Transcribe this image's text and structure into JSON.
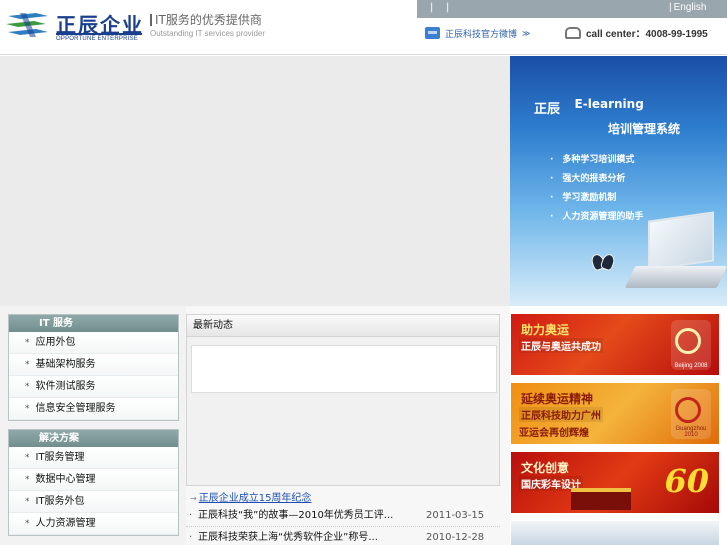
{
  "header": {
    "logo_cn": "正辰企业",
    "logo_en": "OPPORTUNE ENTERPRISE",
    "slogan_cn": "IT服务的优秀提供商",
    "slogan_en": "Outstanding IT services provider",
    "topbar": {
      "sep1": "|",
      "sep2": "|",
      "lang": "English"
    },
    "weibo_label": "正辰科技官方微博",
    "weibo_arrow": "≫",
    "call_center": "call center：4008-99-1995"
  },
  "banner": {
    "brand": "正辰",
    "title_en": "E-learning",
    "subtitle": "培训管理系统",
    "features": [
      "多种学习培训模式",
      "强大的报表分析",
      "学习激励机制",
      "人力资源管理的助手"
    ]
  },
  "sidebar": {
    "sections": [
      {
        "title": "IT 服务",
        "items": [
          "应用外包",
          "基础架构服务",
          "软件测试服务",
          "信息安全管理服务"
        ]
      },
      {
        "title": "解决方案",
        "items": [
          "IT服务管理",
          "数据中心管理",
          "IT服务外包",
          "人力资源管理"
        ]
      }
    ]
  },
  "main": {
    "panel_title": "最新动态",
    "more_link": "正辰企业成立15周年纪念",
    "news": [
      {
        "title": "正辰科技“我”的故事—2010年优秀员工评...",
        "date": "2011-03-15"
      },
      {
        "title": "正辰科技荣获上海“优秀软件企业”称号...",
        "date": "2010-12-28"
      }
    ]
  },
  "ads": [
    {
      "line1": "助力奥运",
      "line2": "正辰与奥运共成功",
      "line3": "",
      "emblem_caption": "Beijing 2008"
    },
    {
      "line1": "延续奥运精神",
      "line2": "正辰科技助力广州",
      "line3": "亚运会再创辉煌",
      "emblem_caption": "Guangzhou 2010"
    },
    {
      "line1": "文化创意",
      "line2": "国庆彩车设计",
      "line3": "",
      "emblem_caption": "60"
    }
  ]
}
